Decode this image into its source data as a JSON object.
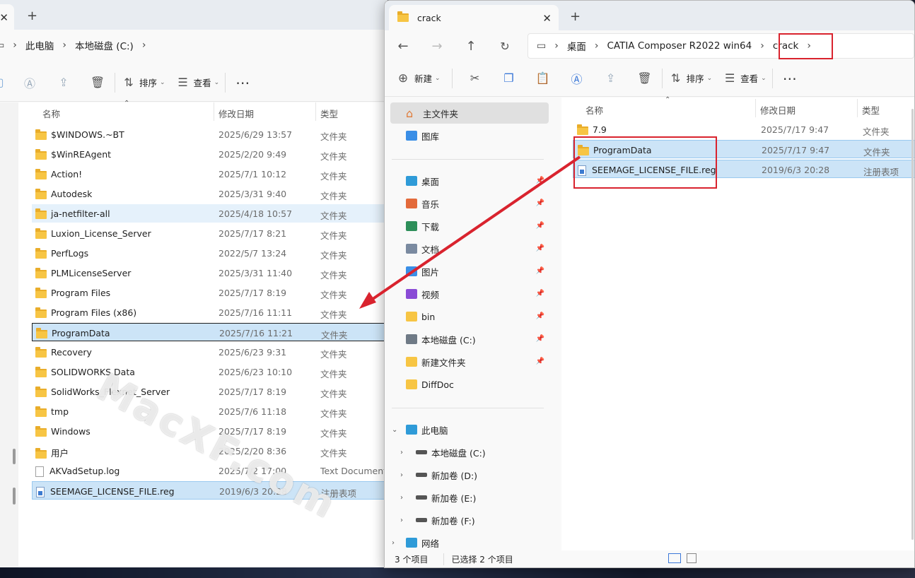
{
  "left_window": {
    "breadcrumb": [
      "此电脑",
      "本地磁盘 (C:)"
    ],
    "toolbar": {
      "sort_label": "排序",
      "view_label": "查看"
    },
    "columns": {
      "name": "名称",
      "date": "修改日期",
      "type": "类型"
    },
    "rows": [
      {
        "name": "$WINDOWS.~BT",
        "date": "2025/6/29 13:57",
        "type": "文件夹",
        "icon": "folder"
      },
      {
        "name": "$WinREAgent",
        "date": "2025/2/20 9:49",
        "type": "文件夹",
        "icon": "folder"
      },
      {
        "name": "Action!",
        "date": "2025/7/1 10:12",
        "type": "文件夹",
        "icon": "folder"
      },
      {
        "name": "Autodesk",
        "date": "2025/3/31 9:40",
        "type": "文件夹",
        "icon": "folder"
      },
      {
        "name": "ja-netfilter-all",
        "date": "2025/4/18 10:57",
        "type": "文件夹",
        "icon": "folder"
      },
      {
        "name": "Luxion_License_Server",
        "date": "2025/7/17 8:21",
        "type": "文件夹",
        "icon": "folder"
      },
      {
        "name": "PerfLogs",
        "date": "2022/5/7 13:24",
        "type": "文件夹",
        "icon": "folder"
      },
      {
        "name": "PLMLicenseServer",
        "date": "2025/3/31 11:40",
        "type": "文件夹",
        "icon": "folder"
      },
      {
        "name": "Program Files",
        "date": "2025/7/17 8:19",
        "type": "文件夹",
        "icon": "folder"
      },
      {
        "name": "Program Files (x86)",
        "date": "2025/7/16 11:11",
        "type": "文件夹",
        "icon": "folder"
      },
      {
        "name": "ProgramData",
        "date": "2025/7/16 11:21",
        "type": "文件夹",
        "icon": "folder"
      },
      {
        "name": "Recovery",
        "date": "2025/6/23 9:31",
        "type": "文件夹",
        "icon": "folder"
      },
      {
        "name": "SOLIDWORKS Data",
        "date": "2025/6/23 10:10",
        "type": "文件夹",
        "icon": "folder"
      },
      {
        "name": "SolidWorks_Flexnet_Server",
        "date": "2025/7/17 8:19",
        "type": "文件夹",
        "icon": "folder"
      },
      {
        "name": "tmp",
        "date": "2025/7/6 11:18",
        "type": "文件夹",
        "icon": "folder"
      },
      {
        "name": "Windows",
        "date": "2025/7/17 8:19",
        "type": "文件夹",
        "icon": "folder"
      },
      {
        "name": "用户",
        "date": "2025/2/20 8:36",
        "type": "文件夹",
        "icon": "folder"
      },
      {
        "name": "AKVadSetup.log",
        "date": "2025/7/2 17:00",
        "type": "Text Document",
        "icon": "text"
      },
      {
        "name": "SEEMAGE_LICENSE_FILE.reg",
        "date": "2019/6/3 20:28",
        "type": "注册表项",
        "icon": "reg"
      }
    ]
  },
  "right_window": {
    "tab_title": "crack",
    "breadcrumb": [
      "桌面",
      "CATIA Composer R2022 win64",
      "crack"
    ],
    "toolbar": {
      "new_label": "新建",
      "sort_label": "排序",
      "view_label": "查看"
    },
    "nav": {
      "quick": [
        {
          "label": "主文件夹",
          "icon": "home-icon"
        },
        {
          "label": "图库",
          "icon": "gallery-icon"
        }
      ],
      "pinned": [
        {
          "label": "桌面",
          "icon": "desktop-icon"
        },
        {
          "label": "音乐",
          "icon": "music-icon"
        },
        {
          "label": "下载",
          "icon": "download-icon"
        },
        {
          "label": "文档",
          "icon": "documents-icon"
        },
        {
          "label": "图片",
          "icon": "pictures-icon"
        },
        {
          "label": "视频",
          "icon": "videos-icon"
        },
        {
          "label": "bin",
          "icon": "folder-icon"
        },
        {
          "label": "本地磁盘 (C:)",
          "icon": "drive-icon"
        },
        {
          "label": "新建文件夹",
          "icon": "folder-icon"
        },
        {
          "label": "DiffDoc",
          "icon": "folder-icon"
        }
      ],
      "this_pc": "此电脑",
      "drives": [
        "本地磁盘 (C:)",
        "新加卷 (D:)",
        "新加卷 (E:)",
        "新加卷 (F:)"
      ],
      "network": "网络"
    },
    "columns": {
      "name": "名称",
      "date": "修改日期",
      "type": "类型"
    },
    "rows": [
      {
        "name": "7.9",
        "date": "2025/7/17 9:47",
        "type": "文件夹",
        "icon": "folder"
      },
      {
        "name": "ProgramData",
        "date": "2025/7/17 9:47",
        "type": "文件夹",
        "icon": "folder"
      },
      {
        "name": "SEEMAGE_LICENSE_FILE.reg",
        "date": "2019/6/3 20:28",
        "type": "注册表项",
        "icon": "reg"
      }
    ],
    "status": {
      "count": "3 个项目",
      "selected": "已选择 2 个项目"
    }
  },
  "watermark": "MacXF.com",
  "colors": {
    "selection": "#cce4f7",
    "highlight_box": "#d9232e",
    "arrow": "#d9232e",
    "folder": "#f7c544"
  }
}
